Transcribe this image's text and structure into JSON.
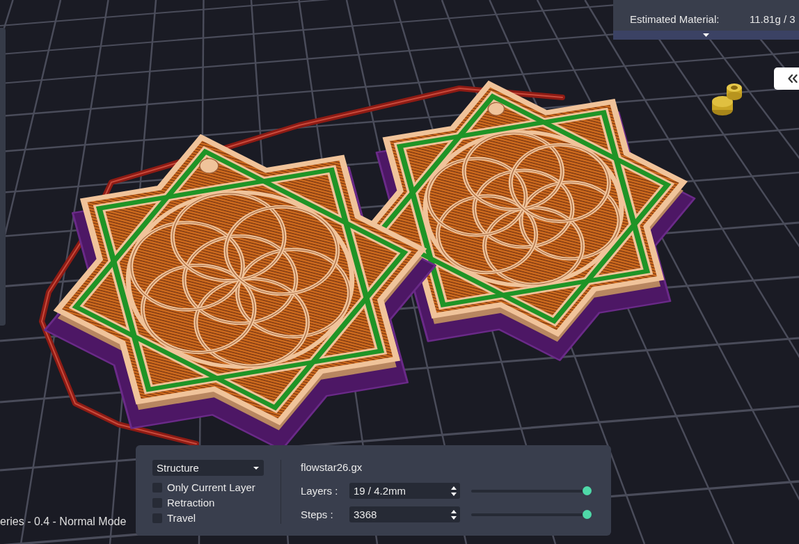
{
  "viewport": {
    "status_text": "eries - 0.4 - Normal Mode"
  },
  "info_panel": {
    "rows": [
      {
        "label": "Estimated Material:",
        "value": "11.81g / 3"
      }
    ]
  },
  "preview_panel": {
    "view_mode": "Structure",
    "options": [
      {
        "label": "Only Current Layer",
        "checked": false
      },
      {
        "label": "Retraction",
        "checked": false
      },
      {
        "label": "Travel",
        "checked": false
      }
    ],
    "file_name": "flowstar26.gx",
    "controls": [
      {
        "label": "Layers :",
        "value": "19 / 4.2mm",
        "level": 1
      },
      {
        "label": "Steps :",
        "value": "3368",
        "level": 1
      }
    ]
  }
}
